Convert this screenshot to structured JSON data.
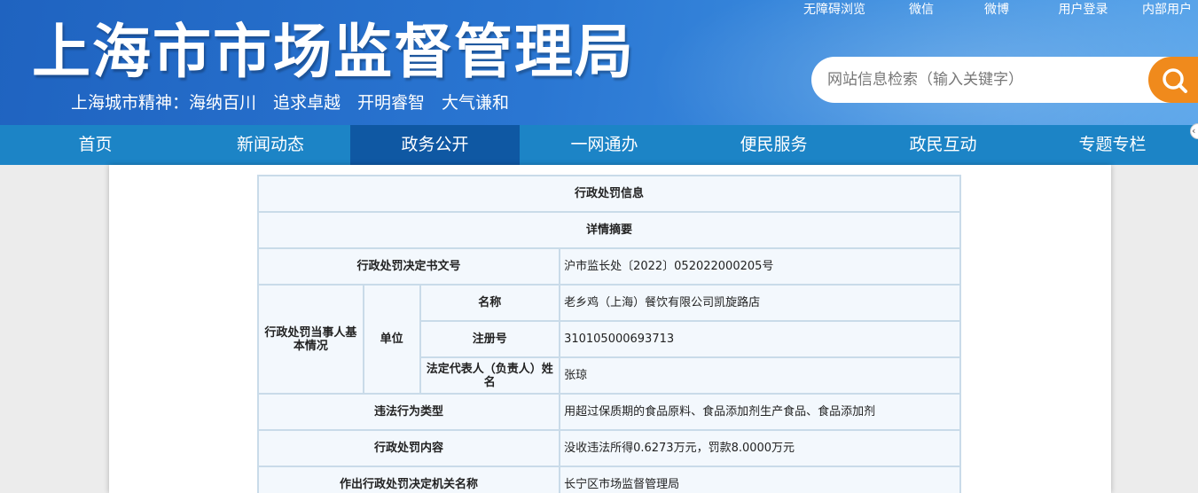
{
  "header": {
    "title": "上海市市场监督管理局",
    "slogan": "上海城市精神：海纳百川　追求卓越　开明睿智　大气谦和",
    "top_links": [
      "无障碍浏览",
      "微信",
      "微博",
      "用户登录",
      "内部用户"
    ],
    "search_placeholder": "网站信息检索（输入关键字）",
    "accent": "#f08a1c"
  },
  "nav": {
    "items": [
      "首页",
      "新闻动态",
      "政务公开",
      "一网通办",
      "便民服务",
      "政民互动",
      "专题专栏"
    ],
    "active": "政务公开"
  },
  "table": {
    "title": "行政处罚信息",
    "subtitle": "详情摘要",
    "decision_no_label": "行政处罚决定书文号",
    "decision_no": "沪市监长处〔2022〕052022000205号",
    "party_label": "行政处罚当事人基本情况",
    "unit_label": "单位",
    "name_label": "名称",
    "name": "老乡鸡（上海）餐饮有限公司凯旋路店",
    "reg_label": "注册号",
    "reg_no": "310105000693713",
    "rep_label": "法定代表人（负责人）姓名",
    "rep_name": "张琼",
    "violation_label": "违法行为类型",
    "violation": "用超过保质期的食品原料、食品添加剂生产食品、食品添加剂",
    "penalty_label": "行政处罚内容",
    "penalty": "没收违法所得0.6273万元，罚款8.0000万元",
    "authority_label": "作出行政处罚决定机关名称",
    "authority": "长宁区市场监督管理局"
  }
}
